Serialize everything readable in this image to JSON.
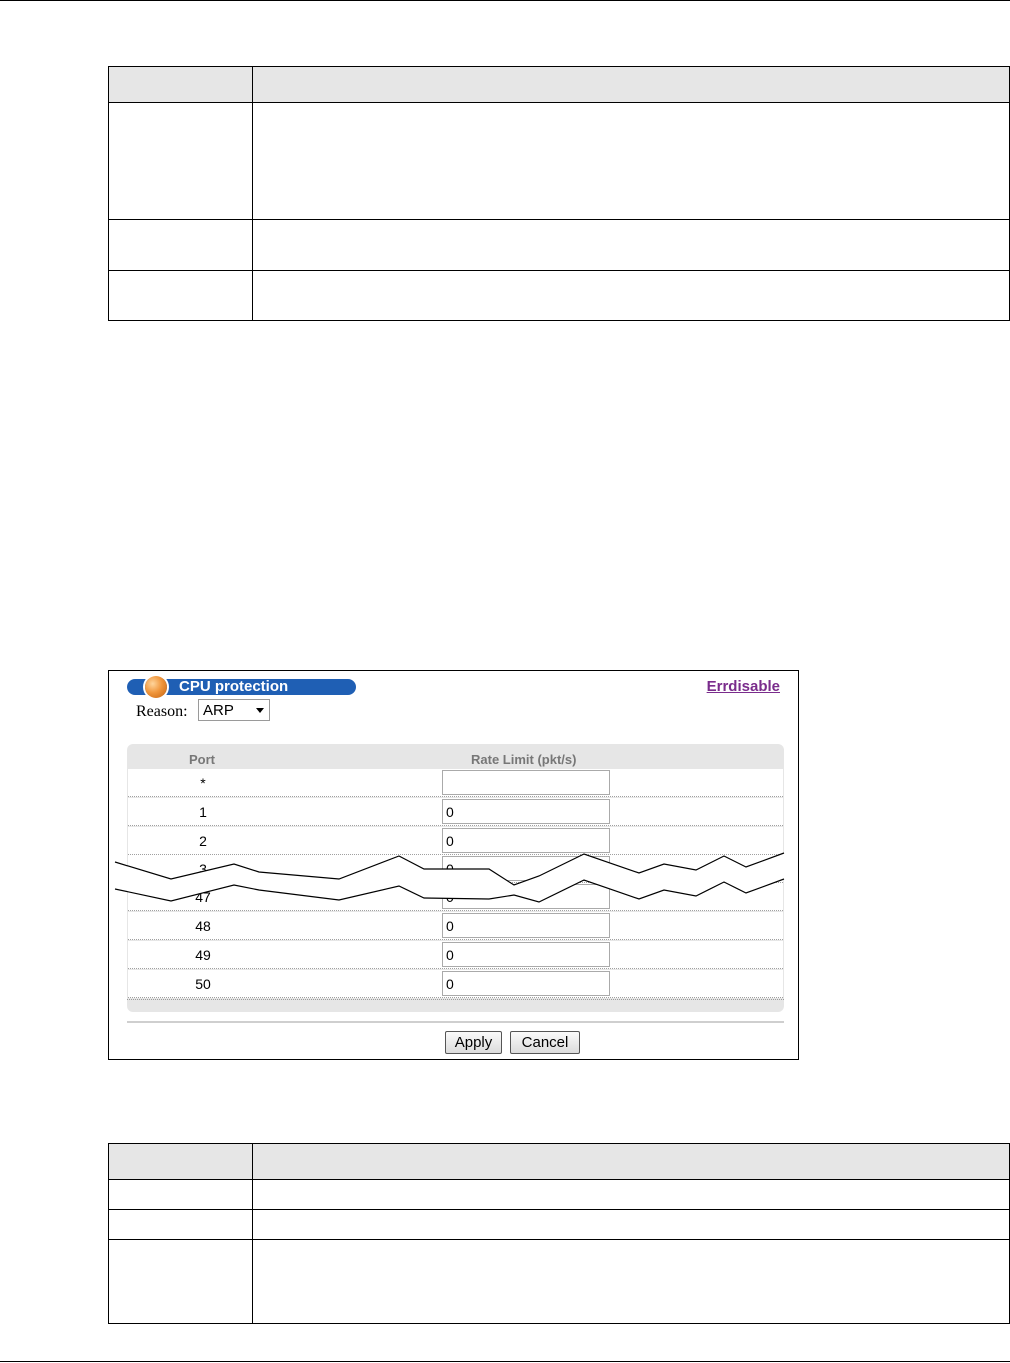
{
  "figure": {
    "title": "CPU protection",
    "link_label": "Errdisable",
    "reason_label": "Reason:",
    "reason_value": "ARP",
    "column_port": "Port",
    "column_rate": "Rate Limit (pkt/s)",
    "rows": [
      {
        "port": "*",
        "value": ""
      },
      {
        "port": "1",
        "value": "0"
      },
      {
        "port": "2",
        "value": "0"
      },
      {
        "port": "3",
        "value": "0"
      },
      {
        "port": "47",
        "value": "0"
      },
      {
        "port": "48",
        "value": "0"
      },
      {
        "port": "49",
        "value": "0"
      },
      {
        "port": "50",
        "value": "0"
      }
    ],
    "apply_label": "Apply",
    "cancel_label": "Cancel"
  }
}
